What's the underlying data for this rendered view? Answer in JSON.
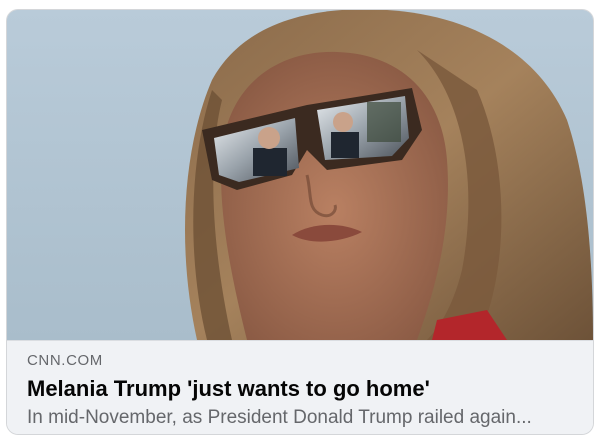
{
  "link_preview": {
    "domain": "CNN.COM",
    "title": "Melania Trump 'just wants to go home'",
    "description": "In mid-November, as President Donald Trump railed again...",
    "image_description": "photo"
  }
}
